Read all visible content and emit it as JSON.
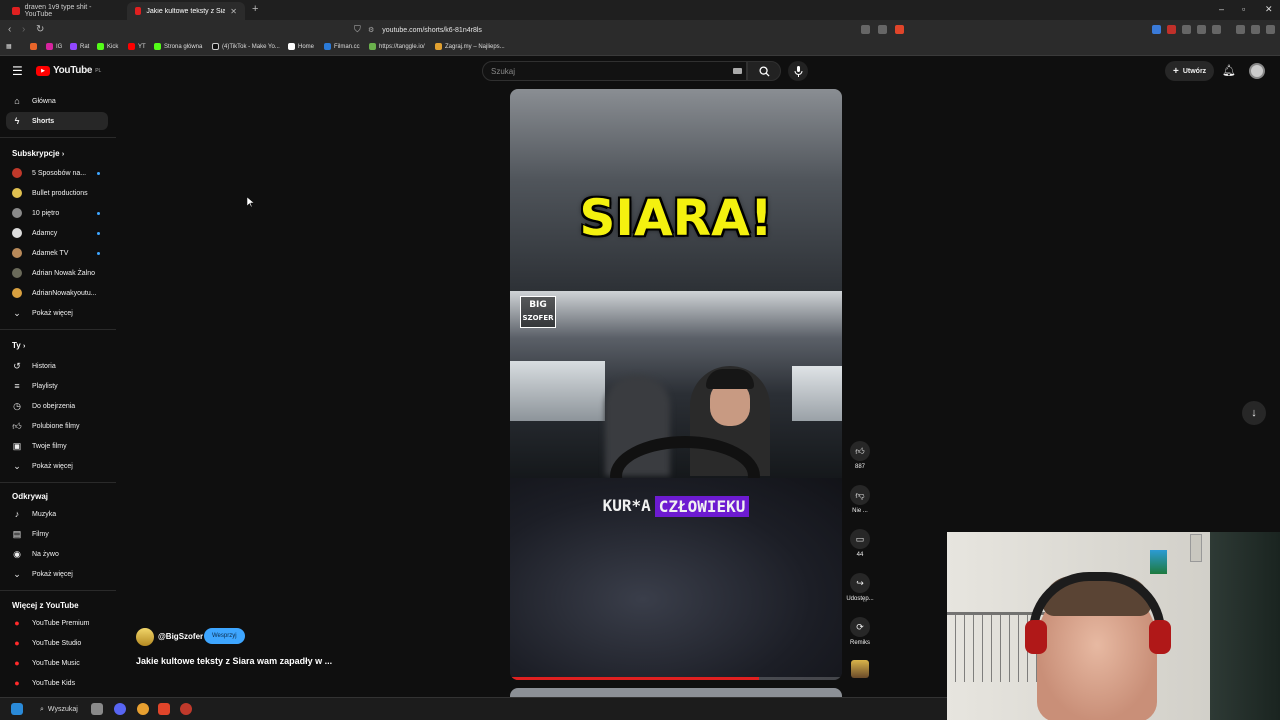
{
  "browser": {
    "tabs": [
      {
        "label": "draven 1v9 type shit - YouTube",
        "active": false
      },
      {
        "label": "Jakie kultowe teksty z Siara w...",
        "active": true
      }
    ],
    "new_tab": "+",
    "url": "youtube.com/shorts/k6-81n4r8ls",
    "bookmarks": [
      {
        "label": "",
        "color": "#e8652a"
      },
      {
        "label": "IG",
        "color": "#d6249f"
      },
      {
        "label": "Rat",
        "color": "#9147ff"
      },
      {
        "label": "Kick",
        "color": "#53fc18"
      },
      {
        "label": "YT",
        "color": "#ff0000"
      },
      {
        "label": "Strona główna",
        "color": "#53fc18"
      },
      {
        "label": "(4)TikTok - Make Yo...",
        "color": "#111111"
      },
      {
        "label": "Home",
        "color": "#ffffff"
      },
      {
        "label": "Filman.cc",
        "color": "#2a7ad8"
      },
      {
        "label": "https://tanggle.io/",
        "color": "#6ab04c"
      },
      {
        "label": "Zagraj.my – Najlieps...",
        "color": "#e0a030"
      }
    ]
  },
  "yt": {
    "logo_text": "YouTube",
    "logo_suffix": "PL",
    "search_placeholder": "Szukaj",
    "create_label": "Utwórz"
  },
  "sidebar": {
    "main": [
      {
        "label": "Główna",
        "icon": "home-icon",
        "active": false
      },
      {
        "label": "Shorts",
        "icon": "shorts-icon",
        "active": true
      }
    ],
    "subs_heading": "Subskrypcje",
    "subs": [
      {
        "label": "5 Sposobów na...",
        "color": "#c0392b",
        "dot": true
      },
      {
        "label": "Bullet productions",
        "color": "#e0c050",
        "dot": false
      },
      {
        "label": "10 piętro",
        "color": "#8a8a8a",
        "dot": true
      },
      {
        "label": "Adamcy",
        "color": "#dddddd",
        "dot": true
      },
      {
        "label": "Adamek TV",
        "color": "#b88a5a",
        "dot": true
      },
      {
        "label": "Adrian Nowak Żalno",
        "color": "#6a6a5a",
        "dot": false
      },
      {
        "label": "AdrianNowakyoutu...",
        "color": "#d8a040",
        "dot": false
      },
      {
        "label": "Pokaż więcej",
        "color": "",
        "dot": false
      }
    ],
    "you_heading": "Ty",
    "you": [
      {
        "label": "Historia",
        "icon": "history-icon"
      },
      {
        "label": "Playlisty",
        "icon": "playlist-icon"
      },
      {
        "label": "Do obejrzenia",
        "icon": "clock-icon"
      },
      {
        "label": "Polubione filmy",
        "icon": "like-icon"
      },
      {
        "label": "Twoje filmy",
        "icon": "video-icon"
      },
      {
        "label": "Pokaż więcej",
        "icon": "chevron-down-icon"
      }
    ],
    "explore_heading": "Odkrywaj",
    "explore": [
      {
        "label": "Muzyka",
        "icon": "music-icon"
      },
      {
        "label": "Filmy",
        "icon": "film-icon"
      },
      {
        "label": "Na żywo",
        "icon": "live-icon"
      },
      {
        "label": "Pokaż więcej",
        "icon": "chevron-down-icon"
      }
    ],
    "more_heading": "Więcej z YouTube",
    "more": [
      {
        "label": "YouTube Premium"
      },
      {
        "label": "YouTube Studio"
      },
      {
        "label": "YouTube Music"
      },
      {
        "label": "YouTube Kids"
      }
    ]
  },
  "short": {
    "overlay_title": "SIARA!",
    "logo_line1": "BIG",
    "logo_line2": "SZOFER",
    "caption_plain": "KUR*A",
    "caption_highlight": "CZŁOWIEKU",
    "progress": 0.75,
    "channel": "@BigSzofer",
    "support_label": "Wesprzyj",
    "title": "Jakie kultowe teksty z Siara wam zapadły w ..."
  },
  "actions": [
    {
      "name": "like",
      "label": "887"
    },
    {
      "name": "dislike",
      "label": "Nie ..."
    },
    {
      "name": "comments",
      "label": "44"
    },
    {
      "name": "share",
      "label": "Udostęp..."
    },
    {
      "name": "remix",
      "label": "Remiks"
    }
  ],
  "taskbar": {
    "search_label": "Wyszukaj"
  }
}
